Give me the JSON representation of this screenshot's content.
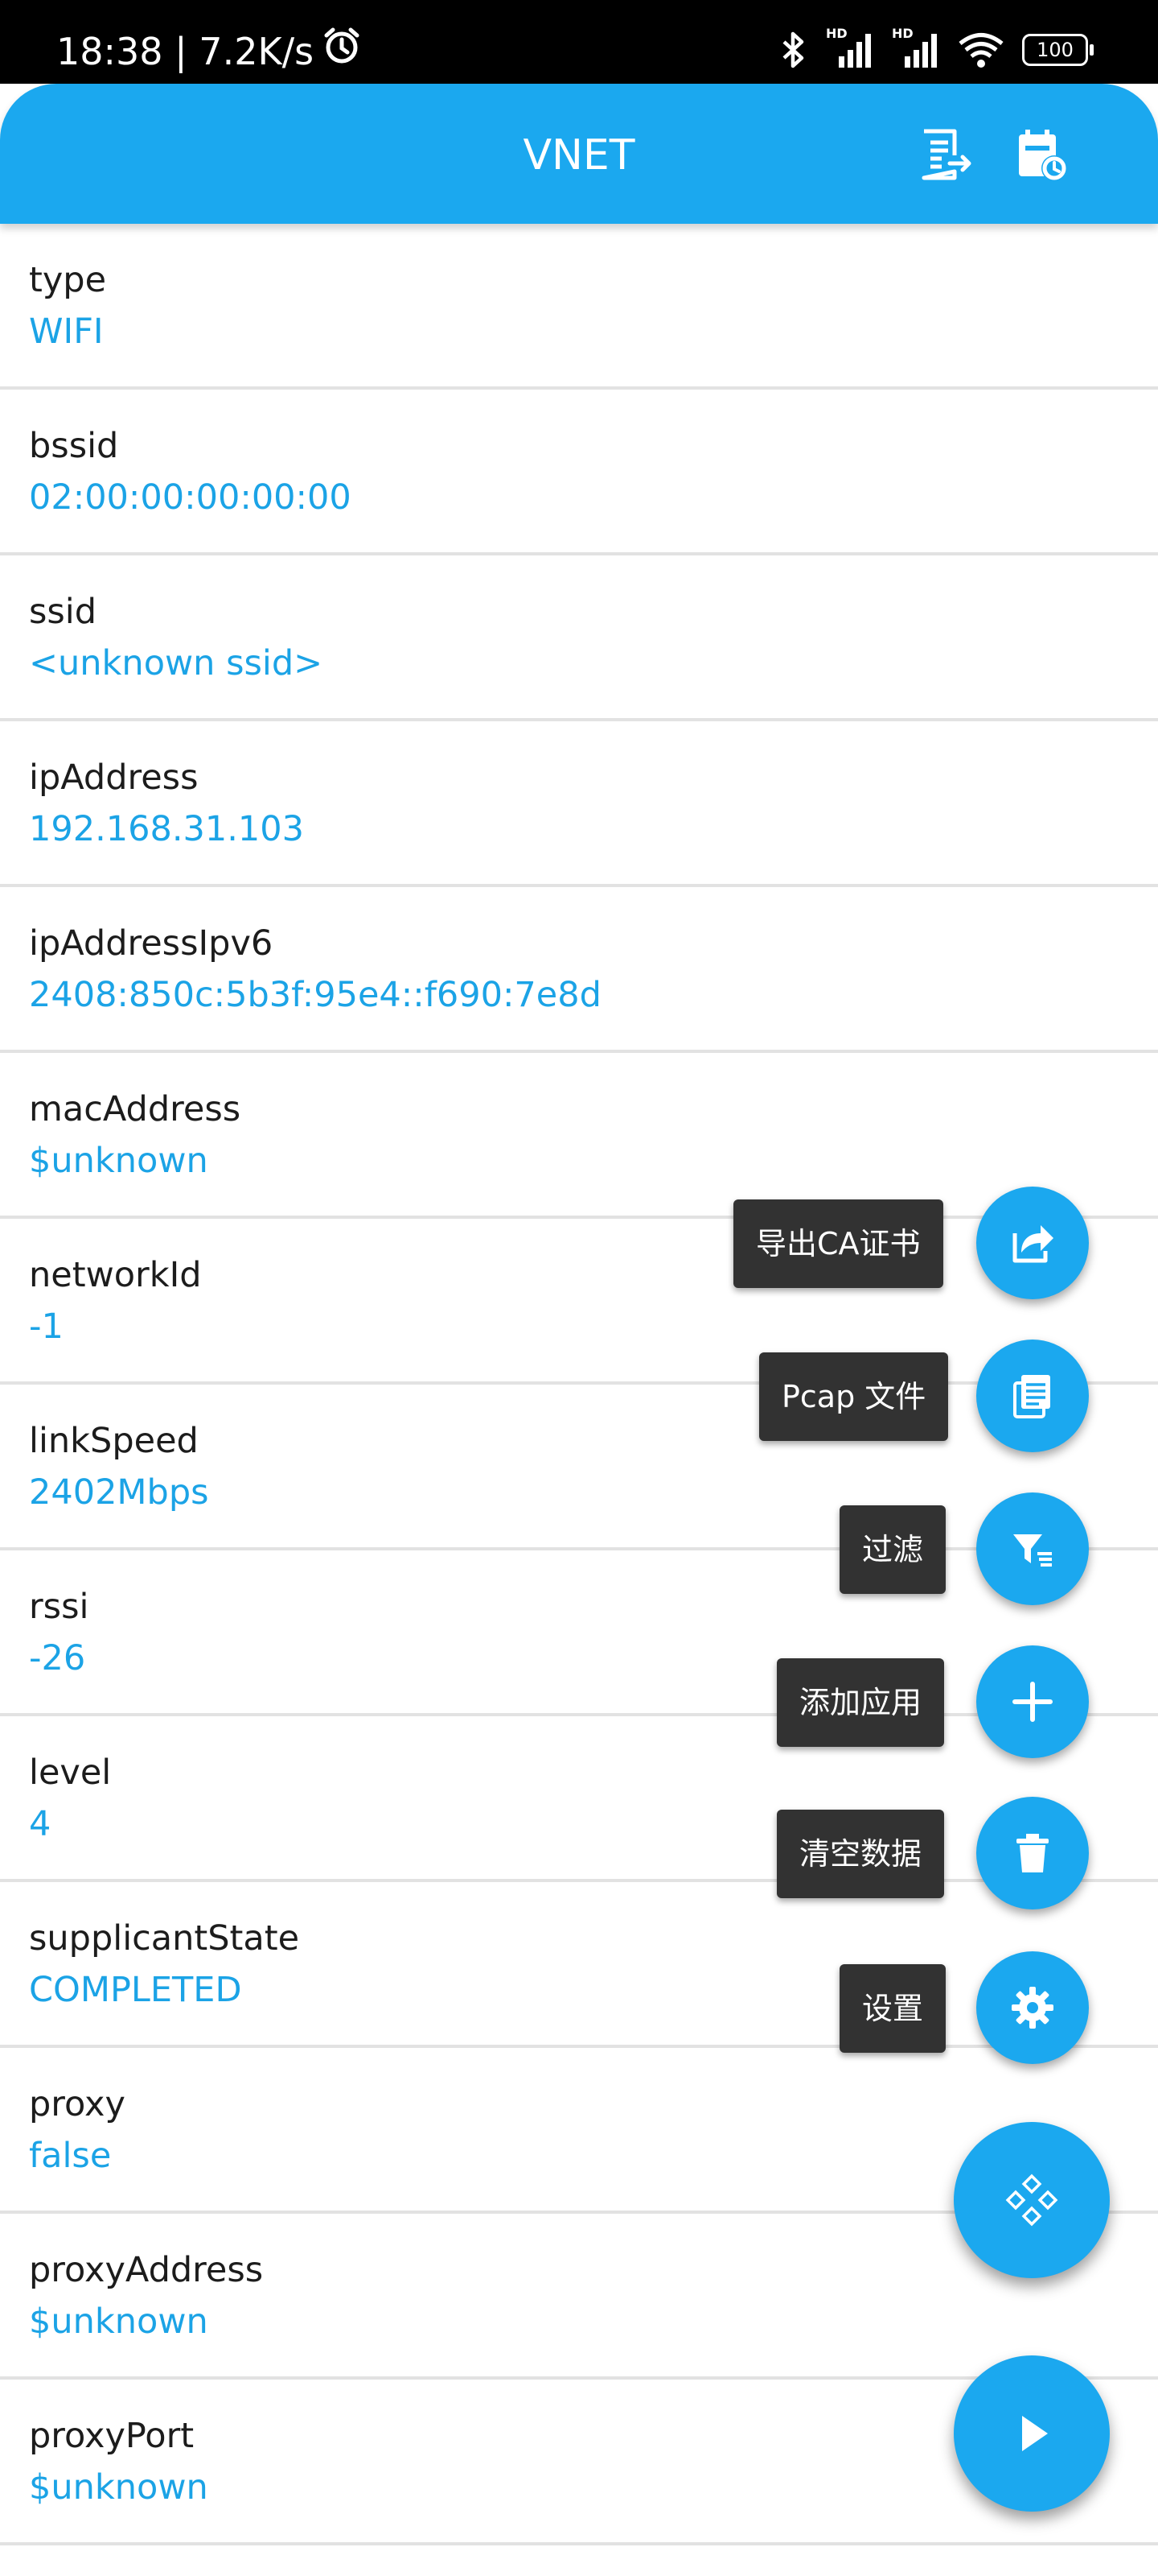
{
  "status_bar": {
    "time_speed": "18:38 | 7.2K/s",
    "battery": "100",
    "hd1": "HD",
    "hd2": "HD"
  },
  "app_bar": {
    "title": "VNET"
  },
  "rows": [
    {
      "label": "type",
      "value": "WIFI"
    },
    {
      "label": "bssid",
      "value": "02:00:00:00:00:00"
    },
    {
      "label": "ssid",
      "value": "<unknown ssid>"
    },
    {
      "label": "ipAddress",
      "value": "192.168.31.103"
    },
    {
      "label": "ipAddressIpv6",
      "value": "2408:850c:5b3f:95e4::f690:7e8d"
    },
    {
      "label": "macAddress",
      "value": "$unknown"
    },
    {
      "label": "networkId",
      "value": "-1"
    },
    {
      "label": "linkSpeed",
      "value": "2402Mbps"
    },
    {
      "label": "rssi",
      "value": "-26"
    },
    {
      "label": "level",
      "value": "4"
    },
    {
      "label": "supplicantState",
      "value": "COMPLETED"
    },
    {
      "label": "proxy",
      "value": "false"
    },
    {
      "label": "proxyAddress",
      "value": "$unknown"
    },
    {
      "label": "proxyPort",
      "value": "$unknown"
    }
  ],
  "speed_dial": {
    "export_ca": "导出CA证书",
    "pcap_file": "Pcap 文件",
    "filter": "过滤",
    "add_app": "添加应用",
    "clear_data": "清空数据",
    "settings": "设置"
  },
  "colors": {
    "primary": "#1BA8EF",
    "value_text": "#1BA3E6",
    "chip_bg": "#323232"
  }
}
